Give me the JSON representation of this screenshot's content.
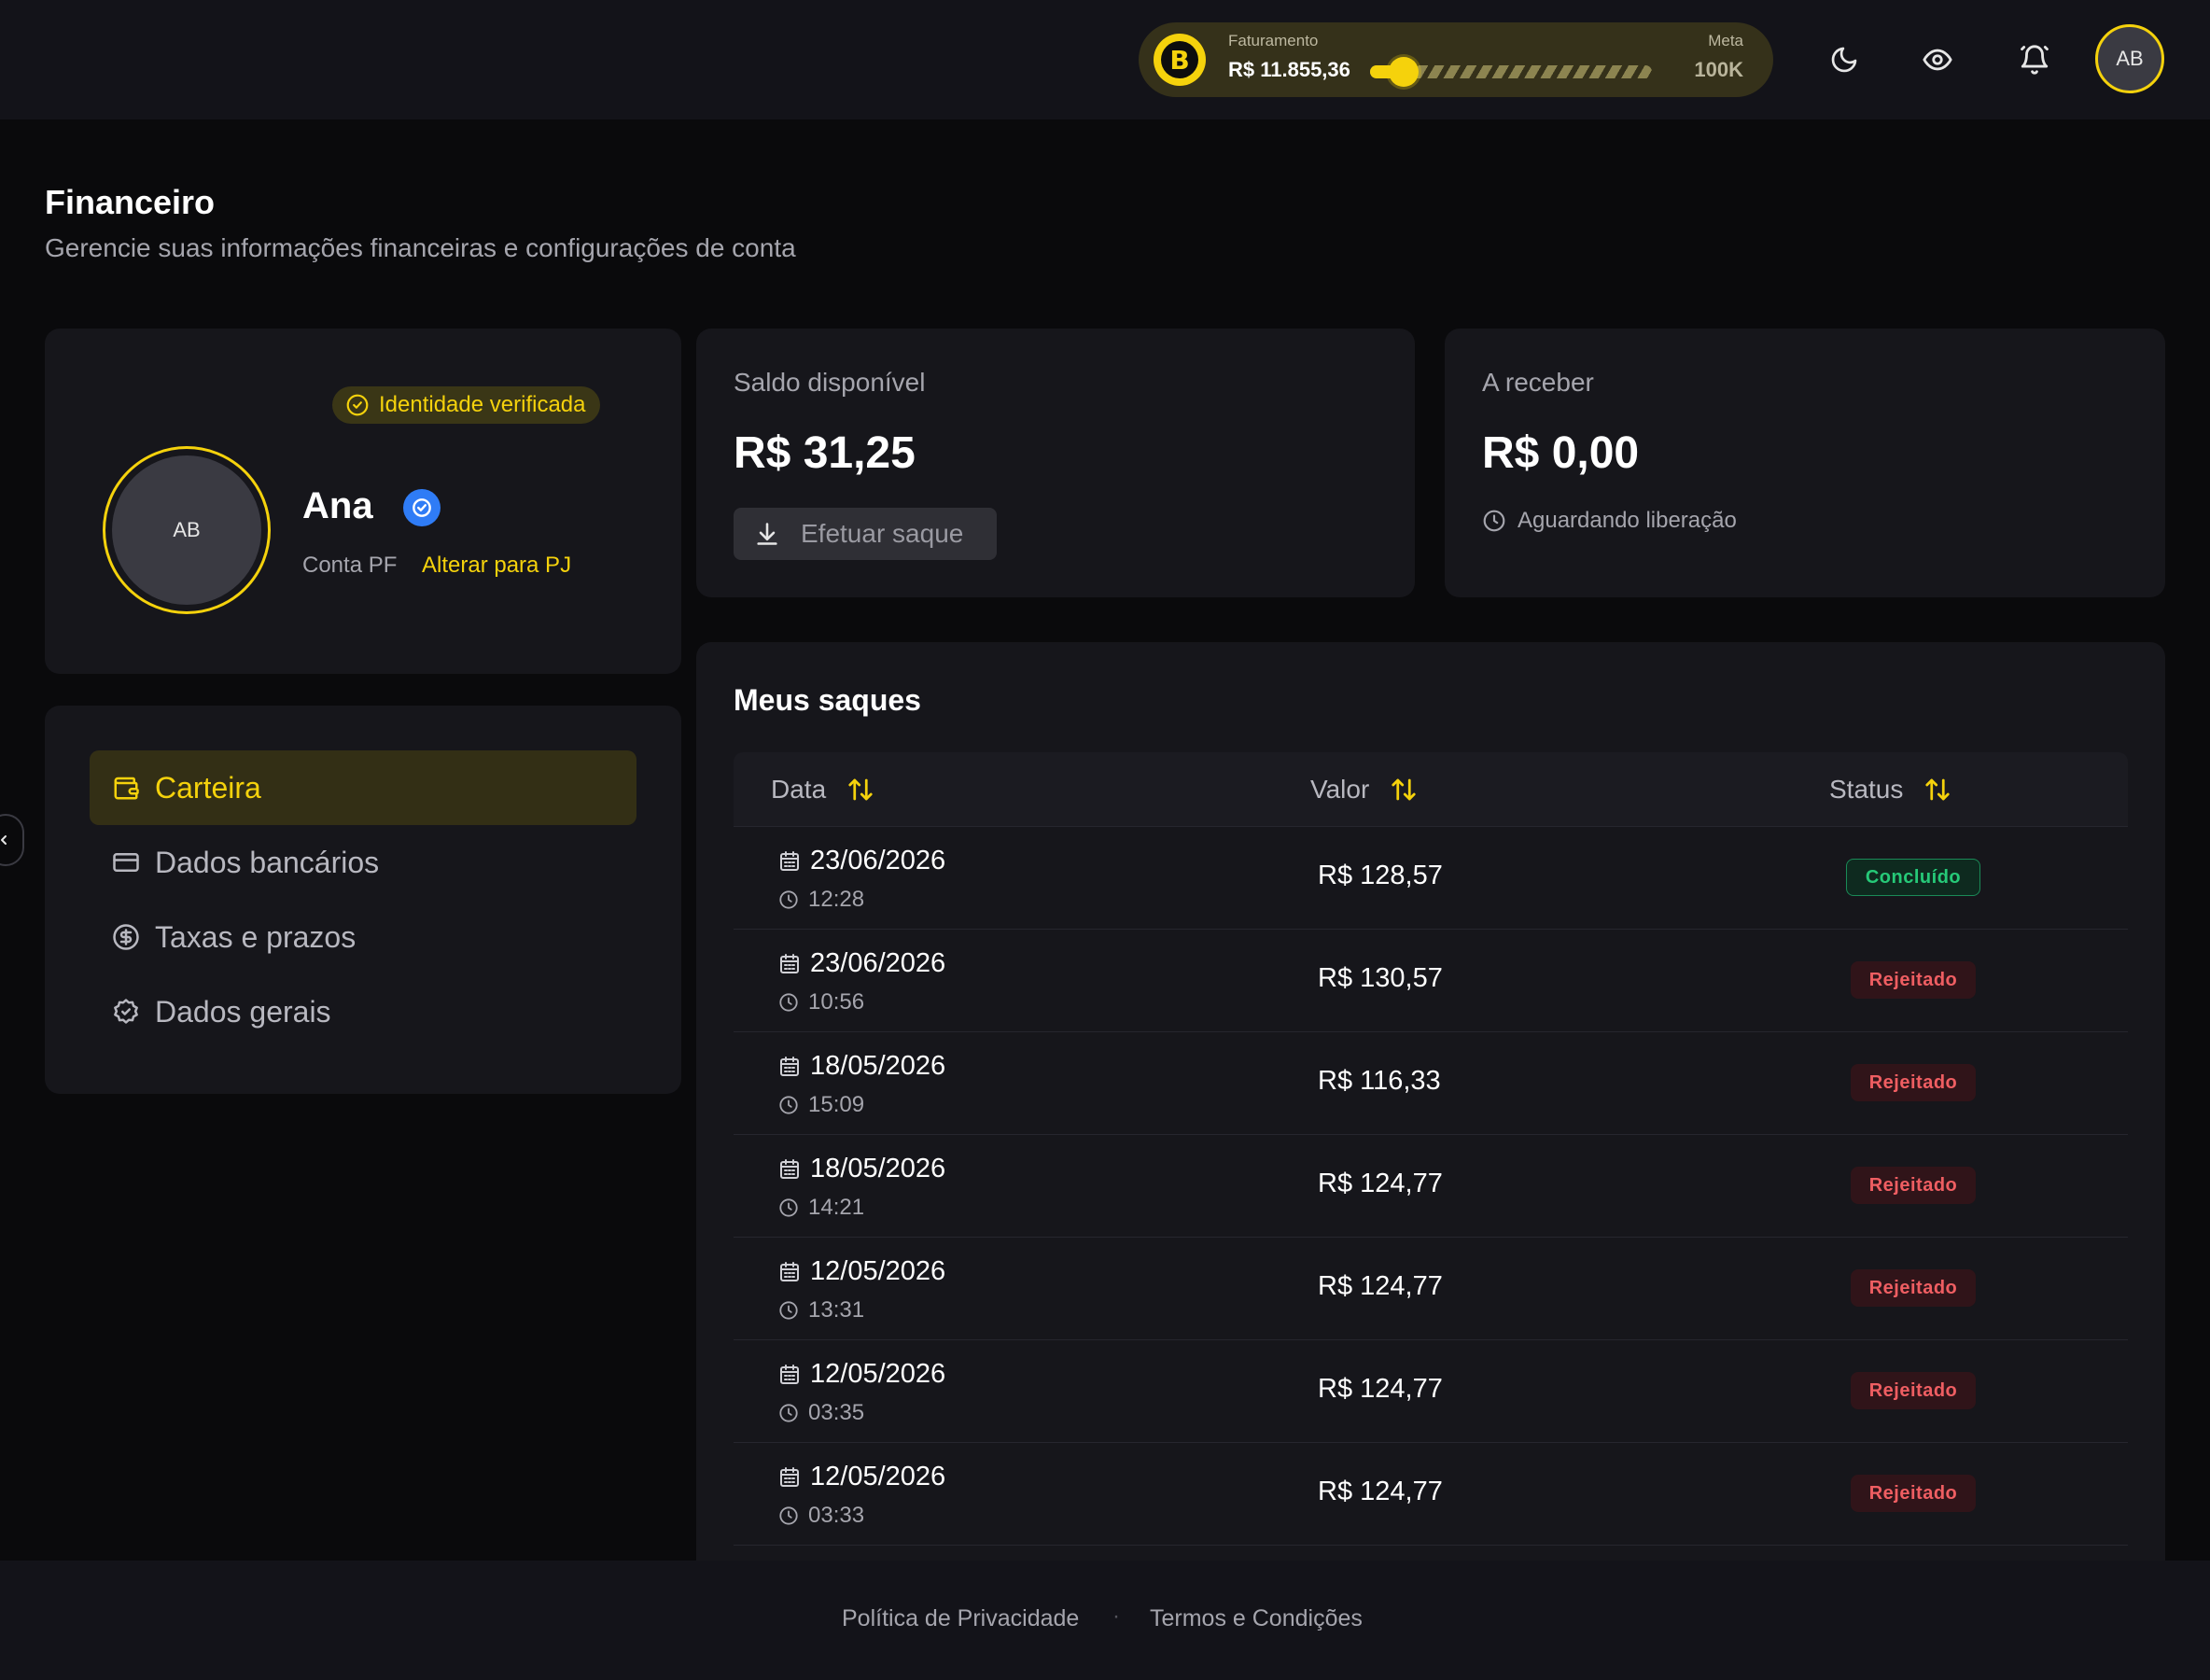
{
  "topbar": {
    "revenue_label": "Faturamento",
    "revenue_value": "R$ 11.855,36",
    "goal_label": "Meta",
    "goal_value": "100K",
    "goal_progress": 0.11855,
    "logo_glyph": "B",
    "user_initials": "AB",
    "icons": [
      "moon-icon",
      "eye-icon",
      "bell-icon"
    ]
  },
  "header": {
    "title": "Financeiro",
    "subtitle": "Gerencie suas informações financeiras e configurações de conta"
  },
  "profile": {
    "verified_label": "Identidade verificada",
    "initials": "AB",
    "name": "Ana",
    "account_type": "Conta PF",
    "switch_label": "Alterar para PJ"
  },
  "menu": {
    "items": [
      {
        "label": "Carteira",
        "icon": "wallet-icon",
        "active": true
      },
      {
        "label": "Dados bancários",
        "icon": "card-icon",
        "active": false
      },
      {
        "label": "Taxas e prazos",
        "icon": "dollar-icon",
        "active": false
      },
      {
        "label": "Dados gerais",
        "icon": "badge-check-icon",
        "active": false
      }
    ]
  },
  "balance": {
    "label": "Saldo disponível",
    "amount": "R$ 31,25",
    "withdraw_label": "Efetuar saque"
  },
  "receivable": {
    "label": "A receber",
    "amount": "R$ 0,00",
    "note": "Aguardando liberação"
  },
  "withdrawals": {
    "title": "Meus saques",
    "columns": {
      "date": "Data",
      "value": "Valor",
      "status": "Status"
    },
    "rows": [
      {
        "date": "23/06/2026",
        "time": "12:28",
        "value": "R$ 128,57",
        "status": "Concluído"
      },
      {
        "date": "23/06/2026",
        "time": "10:56",
        "value": "R$ 130,57",
        "status": "Rejeitado"
      },
      {
        "date": "18/05/2026",
        "time": "15:09",
        "value": "R$ 116,33",
        "status": "Rejeitado"
      },
      {
        "date": "18/05/2026",
        "time": "14:21",
        "value": "R$ 124,77",
        "status": "Rejeitado"
      },
      {
        "date": "12/05/2026",
        "time": "13:31",
        "value": "R$ 124,77",
        "status": "Rejeitado"
      },
      {
        "date": "12/05/2026",
        "time": "03:35",
        "value": "R$ 124,77",
        "status": "Rejeitado"
      },
      {
        "date": "12/05/2026",
        "time": "03:33",
        "value": "R$ 124,77",
        "status": "Rejeitado"
      }
    ]
  },
  "footer": {
    "privacy_label": "Política de Privacidade",
    "separator": "·",
    "terms_label": "Termos e Condições"
  },
  "colors": {
    "accent": "#f5d20c",
    "success": "#26c978",
    "danger": "#ef5e62",
    "verified_blue": "#2f7cf6"
  }
}
